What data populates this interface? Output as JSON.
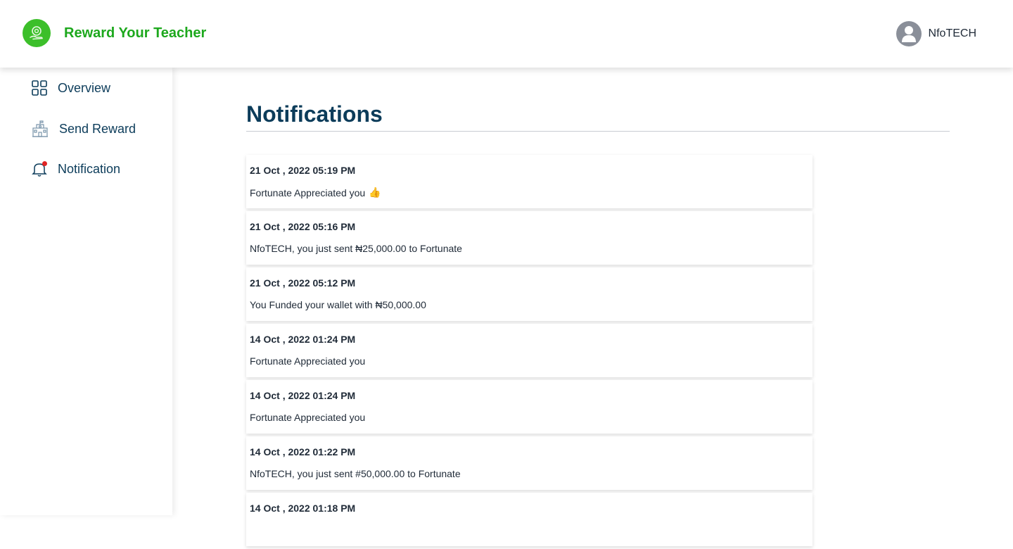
{
  "header": {
    "brand": "Reward Your Teacher",
    "user_name": "NfoTECH"
  },
  "sidebar": {
    "items": [
      {
        "label": "Overview",
        "icon": "grid-icon"
      },
      {
        "label": "Send Reward",
        "icon": "school-building-icon"
      },
      {
        "label": "Notification",
        "icon": "bell-icon",
        "badge_color": "#e02424"
      }
    ]
  },
  "main": {
    "title": "Notifications",
    "notifications": [
      {
        "date": "21 Oct , 2022 05:19 PM",
        "message": "Fortunate Appreciated you",
        "emoji": "👍"
      },
      {
        "date": "21 Oct , 2022 05:16 PM",
        "message": "NfoTECH, you just sent ₦25,000.00 to Fortunate"
      },
      {
        "date": "21 Oct , 2022 05:12 PM",
        "message": "You Funded your wallet with ₦50,000.00"
      },
      {
        "date": "14 Oct , 2022 01:24 PM",
        "message": "Fortunate Appreciated you"
      },
      {
        "date": "14 Oct , 2022 01:24 PM",
        "message": "Fortunate Appreciated you"
      },
      {
        "date": "14 Oct , 2022 01:22 PM",
        "message": "NfoTECH, you just sent #50,000.00 to Fortunate"
      },
      {
        "date": "14 Oct , 2022 01:18 PM",
        "message": ""
      }
    ]
  },
  "colors": {
    "brand_green": "#1da81d",
    "navy": "#0c3c5a",
    "text": "#1f2a37"
  }
}
